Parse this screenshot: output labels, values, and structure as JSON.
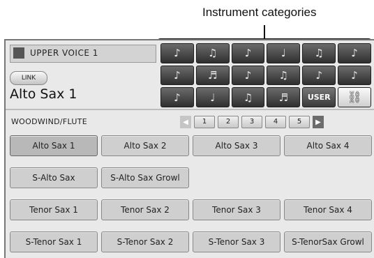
{
  "annotation": {
    "label": "Instrument categories"
  },
  "header": {
    "part_label": "UPPER VOICE 1",
    "link_label": "LINK",
    "voice_name": "Alto Sax 1"
  },
  "category_icons": [
    {
      "name": "piano-icon",
      "glyph": "♪"
    },
    {
      "name": "strings-icon",
      "glyph": "♫"
    },
    {
      "name": "brass-icon",
      "glyph": "♪"
    },
    {
      "name": "woodwind-icon",
      "glyph": "♩"
    },
    {
      "name": "mallet-icon",
      "glyph": "♫"
    },
    {
      "name": "chorus-icon",
      "glyph": "♪"
    },
    {
      "name": "guitar-icon",
      "glyph": "♪"
    },
    {
      "name": "synth-keyboard-icon",
      "glyph": "♬"
    },
    {
      "name": "organ-icon",
      "glyph": "♪"
    },
    {
      "name": "harp-icon",
      "glyph": "♫"
    },
    {
      "name": "sound-effect-icon",
      "glyph": "♪"
    },
    {
      "name": "amplifier-icon",
      "glyph": "♪"
    },
    {
      "name": "world-icon",
      "glyph": "♪"
    },
    {
      "name": "bass-icon",
      "glyph": "♩"
    },
    {
      "name": "percussion-icon",
      "glyph": "♫"
    },
    {
      "name": "rhythm-keyboard-icon",
      "glyph": "♬"
    },
    {
      "name": "user-button",
      "label": "USER"
    },
    {
      "name": "link-icon",
      "glyph": "⛓"
    }
  ],
  "category": {
    "name": "WOODWIND/FLUTE"
  },
  "pages": [
    "1",
    "2",
    "3",
    "4",
    "5"
  ],
  "voices": [
    {
      "label": "Alto Sax 1",
      "selected": true
    },
    {
      "label": "Alto Sax 2"
    },
    {
      "label": "Alto Sax 3"
    },
    {
      "label": "Alto Sax 4"
    },
    {
      "label": "S-Alto Sax"
    },
    {
      "label": "S-Alto Sax Growl"
    },
    {
      "label": "Tenor Sax 1"
    },
    {
      "label": "Tenor Sax 2"
    },
    {
      "label": "Tenor Sax 3"
    },
    {
      "label": "Tenor Sax 4"
    },
    {
      "label": "S-Tenor Sax 1"
    },
    {
      "label": "S-Tenor Sax 2"
    },
    {
      "label": "S-Tenor Sax 3"
    },
    {
      "label": "S-TenorSax Growl"
    }
  ]
}
